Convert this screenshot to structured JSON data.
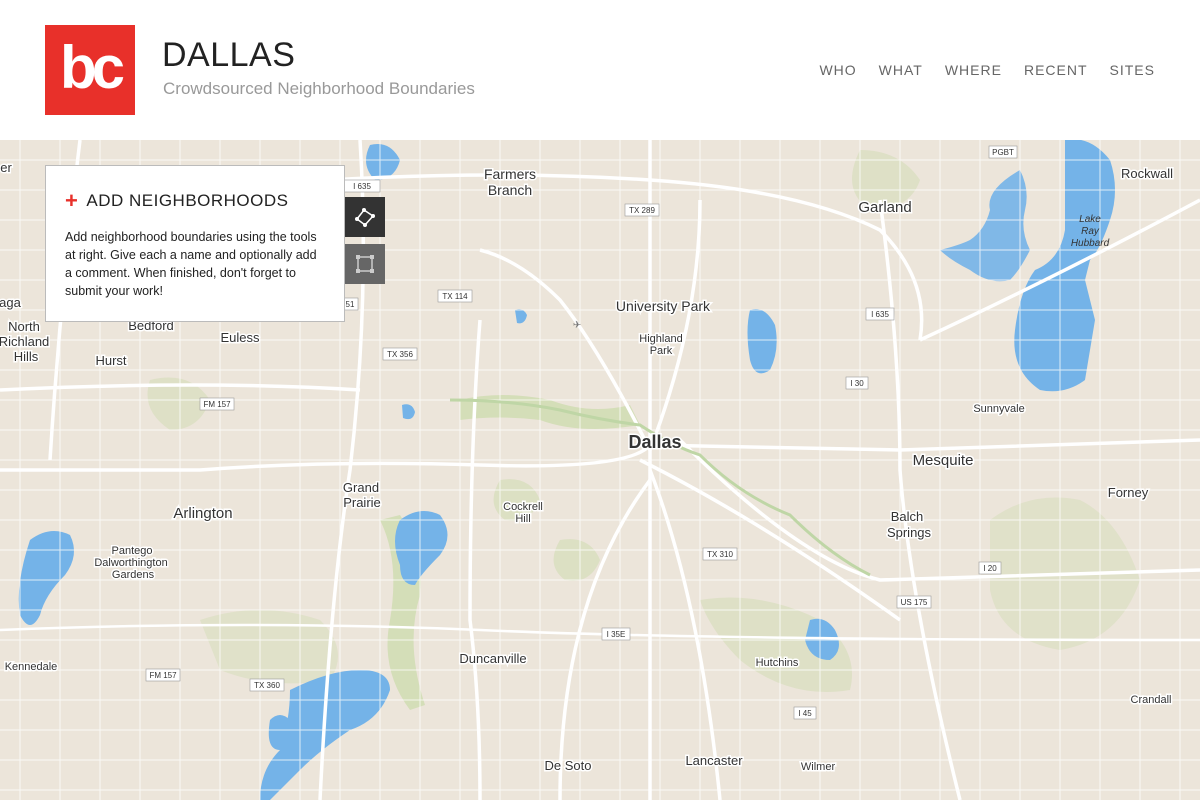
{
  "brand": {
    "logo_text": "bc",
    "title": "DALLAS",
    "subtitle": "Crowdsourced Neighborhood Boundaries"
  },
  "nav": [
    "WHO",
    "WHAT",
    "WHERE",
    "RECENT",
    "SITES"
  ],
  "panel": {
    "title": "ADD NEIGHBORHOODS",
    "body": "Add neighborhood boundaries using the tools at right. Give each a name and optionally add a comment. When finished, don't forget to submit your work!"
  },
  "tools": {
    "polygon_icon": "polygon-draw-icon",
    "rectangle_icon": "rectangle-draw-icon"
  },
  "map": {
    "places": [
      {
        "name": "Dallas",
        "tier": "major"
      },
      {
        "name": "Farmers",
        "tier": "city"
      },
      {
        "name": "Branch",
        "tier": "city"
      },
      {
        "name": "Garland",
        "tier": "city"
      },
      {
        "name": "Rockwall",
        "tier": "town"
      },
      {
        "name": "University Park",
        "tier": "town"
      },
      {
        "name": "Highland",
        "tier": "small"
      },
      {
        "name": "Park",
        "tier": "small"
      },
      {
        "name": "Mesquite",
        "tier": "city"
      },
      {
        "name": "Sunnyvale",
        "tier": "small"
      },
      {
        "name": "Forney",
        "tier": "town"
      },
      {
        "name": "Balch",
        "tier": "town"
      },
      {
        "name": "Springs",
        "tier": "town"
      },
      {
        "name": "Grand",
        "tier": "town"
      },
      {
        "name": "Prairie",
        "tier": "town"
      },
      {
        "name": "Arlington",
        "tier": "city"
      },
      {
        "name": "Cockrell",
        "tier": "small"
      },
      {
        "name": "Hill",
        "tier": "small"
      },
      {
        "name": "Pantego",
        "tier": "small"
      },
      {
        "name": "Dalworthington",
        "tier": "small"
      },
      {
        "name": "Gardens",
        "tier": "small"
      },
      {
        "name": "Euless",
        "tier": "town"
      },
      {
        "name": "Bedford",
        "tier": "town"
      },
      {
        "name": "Hurst",
        "tier": "town"
      },
      {
        "name": "North",
        "tier": "town"
      },
      {
        "name": "Richland",
        "tier": "town"
      },
      {
        "name": "Hills",
        "tier": "town"
      },
      {
        "name": "Duncanville",
        "tier": "town"
      },
      {
        "name": "Hutchins",
        "tier": "small"
      },
      {
        "name": "Crandall",
        "tier": "small"
      },
      {
        "name": "De Soto",
        "tier": "town"
      },
      {
        "name": "Lancaster",
        "tier": "town"
      },
      {
        "name": "Wilmer",
        "tier": "small"
      },
      {
        "name": "Kennedale",
        "tier": "small"
      },
      {
        "name": "aga",
        "tier": "small"
      },
      {
        "name": "er",
        "tier": "small"
      },
      {
        "name": "Lake",
        "tier": "water"
      },
      {
        "name": "Ray",
        "tier": "water"
      },
      {
        "name": "Hubbard",
        "tier": "water"
      }
    ],
    "shields": [
      "I 635",
      "TX 289",
      "PGBT",
      "TX 114",
      "TX 356",
      "FM 157",
      "I 635",
      "I 30",
      "TX 310",
      "I 20",
      "US 175",
      "I 35E",
      "I 45",
      "FM 157",
      "TX 360",
      "51"
    ]
  }
}
